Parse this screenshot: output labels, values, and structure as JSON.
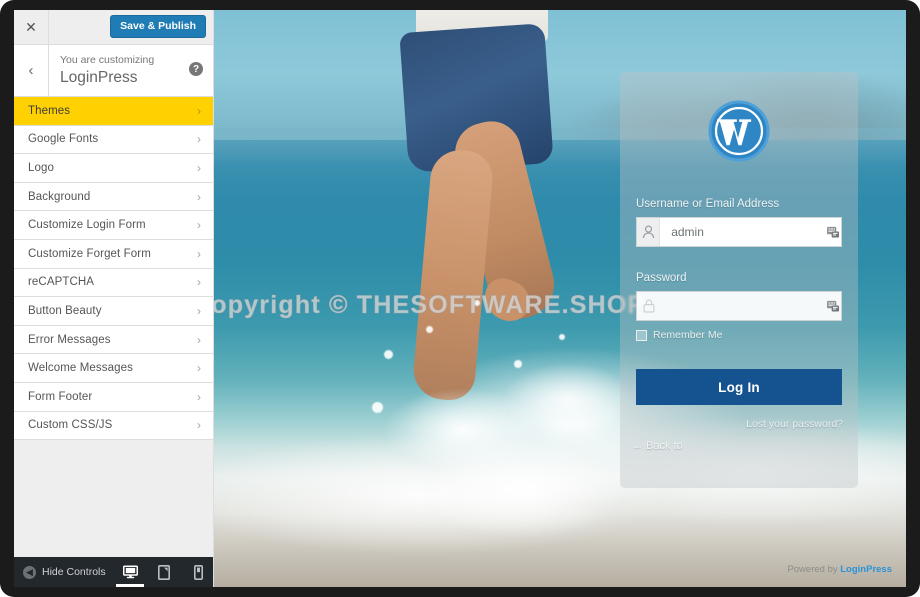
{
  "customizer": {
    "close_icon": "close-icon",
    "save_label": "Save & Publish",
    "back_icon": "chevron-left-icon",
    "eyebrow": "You are customizing",
    "title": "LoginPress",
    "help_icon": "help-icon",
    "help_glyph": "?",
    "accent_yellow": "#ffd100",
    "save_button_color": "#1f7cb4",
    "menu": [
      {
        "label": "Themes",
        "active": true
      },
      {
        "label": "Google Fonts",
        "active": false
      },
      {
        "label": "Logo",
        "active": false
      },
      {
        "label": "Background",
        "active": false
      },
      {
        "label": "Customize Login Form",
        "active": false
      },
      {
        "label": "Customize Forget Form",
        "active": false
      },
      {
        "label": "reCAPTCHA",
        "active": false
      },
      {
        "label": "Button Beauty",
        "active": false
      },
      {
        "label": "Error Messages",
        "active": false
      },
      {
        "label": "Welcome Messages",
        "active": false
      },
      {
        "label": "Form Footer",
        "active": false
      },
      {
        "label": "Custom CSS/JS",
        "active": false
      }
    ],
    "footer": {
      "hide_controls_label": "Hide Controls",
      "hide_controls_icon": "collapse-left-icon",
      "devices": [
        {
          "name": "desktop",
          "icon": "desktop-icon",
          "active": true
        },
        {
          "name": "tablet",
          "icon": "tablet-icon",
          "active": false
        },
        {
          "name": "mobile",
          "icon": "mobile-icon",
          "active": false
        }
      ]
    }
  },
  "preview": {
    "watermark": "Copyright © THESOFTWARE.SHOP",
    "login": {
      "logo_icon": "wordpress-logo-icon",
      "username_label": "Username or Email Address",
      "username_value": "admin",
      "username_placeholder": "admin",
      "username_prefix_icon": "user-icon",
      "username_autofill_icon": "autofill-icon",
      "password_label": "Password",
      "password_value": "",
      "password_placeholder": "",
      "password_prefix_icon": "lock-icon",
      "password_autofill_icon": "autofill-icon",
      "remember_label": "Remember Me",
      "remember_checked": false,
      "submit_label": "Log In",
      "submit_color": "#14538f",
      "lost_password_label": "Lost your password?",
      "back_to_label": "← Back to",
      "powered_prefix": "Powered by ",
      "powered_brand": "LoginPress"
    }
  }
}
